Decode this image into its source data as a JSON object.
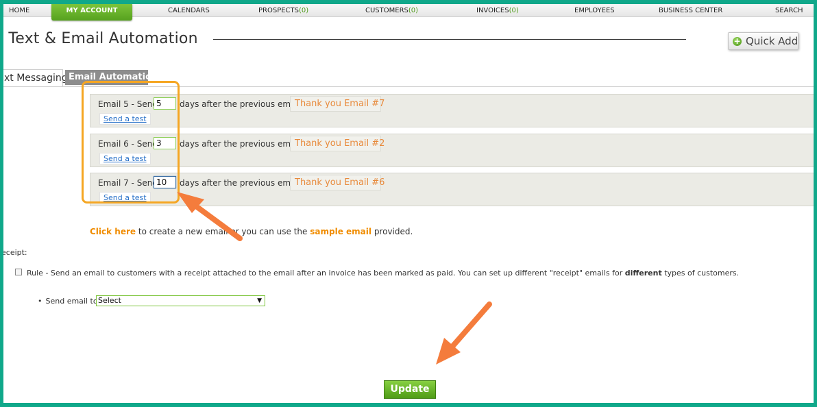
{
  "nav": {
    "home": "HOME",
    "my_account": "MY ACCOUNT",
    "calendars": "CALENDARS",
    "prospects": "PROSPECTS",
    "prospects_count": "(0)",
    "customers": "CUSTOMERS",
    "customers_count": "(0)",
    "invoices": "INVOICES",
    "invoices_count": "(0)",
    "employees": "EMPLOYEES",
    "business_center": "BUSINESS CENTER",
    "search": "SEARCH"
  },
  "page": {
    "title": "- Text & Email Automation",
    "quick_add": "Quick Add",
    "quick_add_icon": "plus-circle-icon"
  },
  "tabs": {
    "text_messaging": "xt Messaging",
    "email_automation": "Email Automation"
  },
  "emails": [
    {
      "label": "Email 5 - Send",
      "days": "5",
      "after": "days after the previous email:",
      "template": "Thank you Email #7",
      "send_test": "Send a test"
    },
    {
      "label": "Email 6 - Send",
      "days": "3",
      "after": "days after the previous email:",
      "template": "Thank you Email #2",
      "send_test": "Send a test"
    },
    {
      "label": "Email 7 - Send",
      "days": "10",
      "after": "days after the previous email:",
      "template": "Thank you Email #6",
      "send_test": "Send a test"
    }
  ],
  "info": {
    "click_here": "Click here",
    "text1": "to create a new email or you can use the",
    "sample_email": "sample email",
    "text2": "provided."
  },
  "receipt": {
    "label": "eceipt:",
    "rule_text_1": "Rule - Send an email to customers with a receipt attached to the email after an invoice has been marked as paid. You can set up different \"receipt\" emails for",
    "rule_bold": "different",
    "rule_text_2": "types of customers.",
    "send_to_label": "Send email to",
    "select_value": "Select"
  },
  "update_label": "Update",
  "colors": {
    "accent_green": "#5aa820",
    "template_orange": "#e8893a",
    "link_orange": "#f08c00",
    "annotation_orange": "#f47c3c",
    "highlight_yellow": "#f5a623",
    "frame_teal": "#10a88a"
  }
}
